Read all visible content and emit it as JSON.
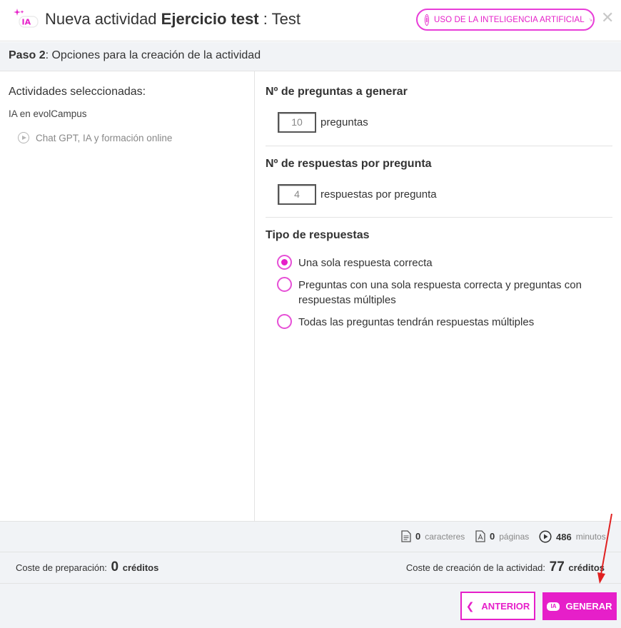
{
  "header": {
    "title_prefix": "Nueva actividad",
    "title_bold": "Ejercicio test",
    "title_suffix": ": Test",
    "ai_usage_label": "USO DE LA INTELIGENCIA ARTIFICIAL",
    "close_icon": "close-icon"
  },
  "step": {
    "label": "Paso 2",
    "text": ": Opciones para la creación de la actividad"
  },
  "selection": {
    "heading": "Actividades seleccionadas:",
    "course": "IA en evolCampus",
    "item": "Chat GPT, IA y formación online"
  },
  "questions": {
    "heading": "Nº de preguntas a generar",
    "value": "10",
    "unit": "preguntas"
  },
  "answers": {
    "heading": "Nº de respuestas por pregunta",
    "value": "4",
    "unit": "respuestas por pregunta"
  },
  "answer_type": {
    "heading": "Tipo de respuestas",
    "options": [
      {
        "label": "Una sola respuesta correcta",
        "selected": true
      },
      {
        "label": "Preguntas con una sola respuesta correcta y preguntas con respuestas múltiples",
        "selected": false
      },
      {
        "label": "Todas las preguntas tendrán respuestas múltiples",
        "selected": false
      }
    ]
  },
  "stats": {
    "characters": {
      "value": "0",
      "unit": "caracteres"
    },
    "pages": {
      "value": "0",
      "unit": "páginas"
    },
    "minutes": {
      "value": "486",
      "unit": "minutos"
    }
  },
  "costs": {
    "prep_label": "Coste de preparación:",
    "prep_value": "0",
    "creation_label": "Coste de creación de la actividad:",
    "creation_value": "77",
    "credits_label": "créditos"
  },
  "buttons": {
    "previous": "ANTERIOR",
    "generate": "GENERAR"
  },
  "colors": {
    "accent": "#e61fc9",
    "panel": "#f1f3f6",
    "annotation": "#e02020"
  }
}
